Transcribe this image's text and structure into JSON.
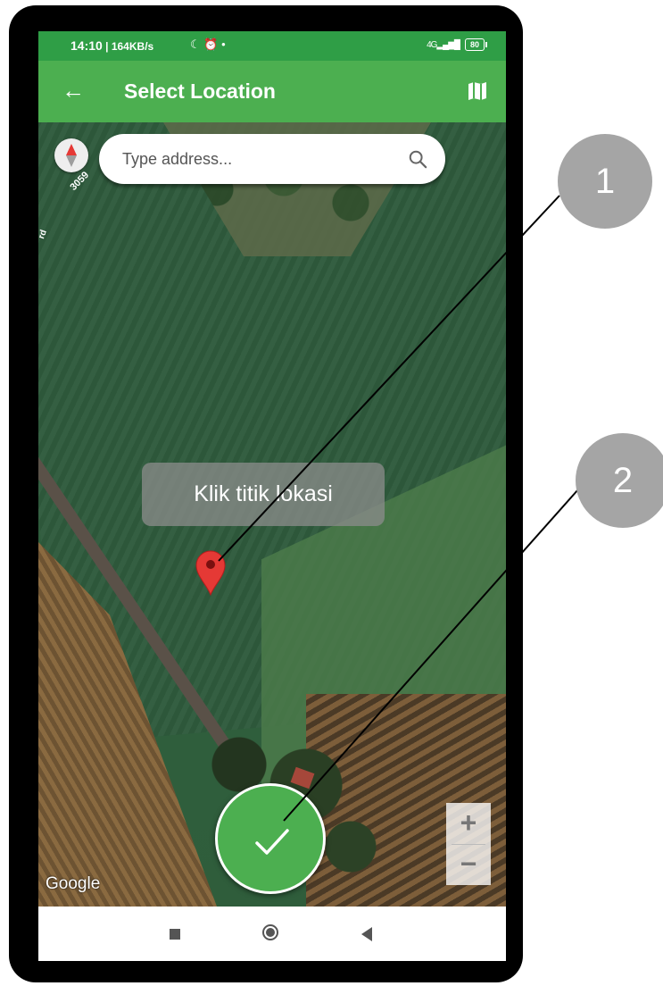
{
  "status_bar": {
    "time": "14:10",
    "speed": " | 164KB/s",
    "icons": "☾ ⏰ •",
    "signal": "4G",
    "battery": "80"
  },
  "app_bar": {
    "title": "Select Location",
    "back_icon": "arrow-left",
    "map_icon": "map"
  },
  "search": {
    "placeholder": "Type address...",
    "value": ""
  },
  "map": {
    "road_label_a": "3059",
    "road_label_b": "rd",
    "google": "Google",
    "zoom_in": "+",
    "zoom_out": "−"
  },
  "tooltip": {
    "text": "Klik titik lokasi"
  },
  "callouts": {
    "one": "1",
    "two": "2"
  },
  "colors": {
    "primary": "#4caf50",
    "status_bar": "#2f9e46",
    "marker": "#e53935",
    "callout": "#a5a5a5"
  }
}
